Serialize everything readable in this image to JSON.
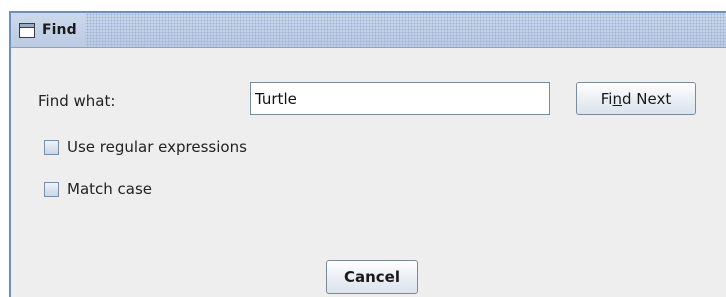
{
  "dialog": {
    "title": "Find",
    "icon": "window-icon"
  },
  "find_what": {
    "label": "Find what:",
    "value": "Turtle"
  },
  "find_next_button": {
    "prefix": "Fi",
    "mnemonic": "n",
    "suffix": "d Next"
  },
  "options": {
    "regex_label": "Use regular expressions",
    "regex_checked": false,
    "match_case_label": "Match case",
    "match_case_checked": false
  },
  "cancel_button": {
    "label": "Cancel"
  },
  "colors": {
    "window_bg": "#eeeeee",
    "title_bar": "#c3d2e8",
    "border": "#6e8fc1"
  }
}
